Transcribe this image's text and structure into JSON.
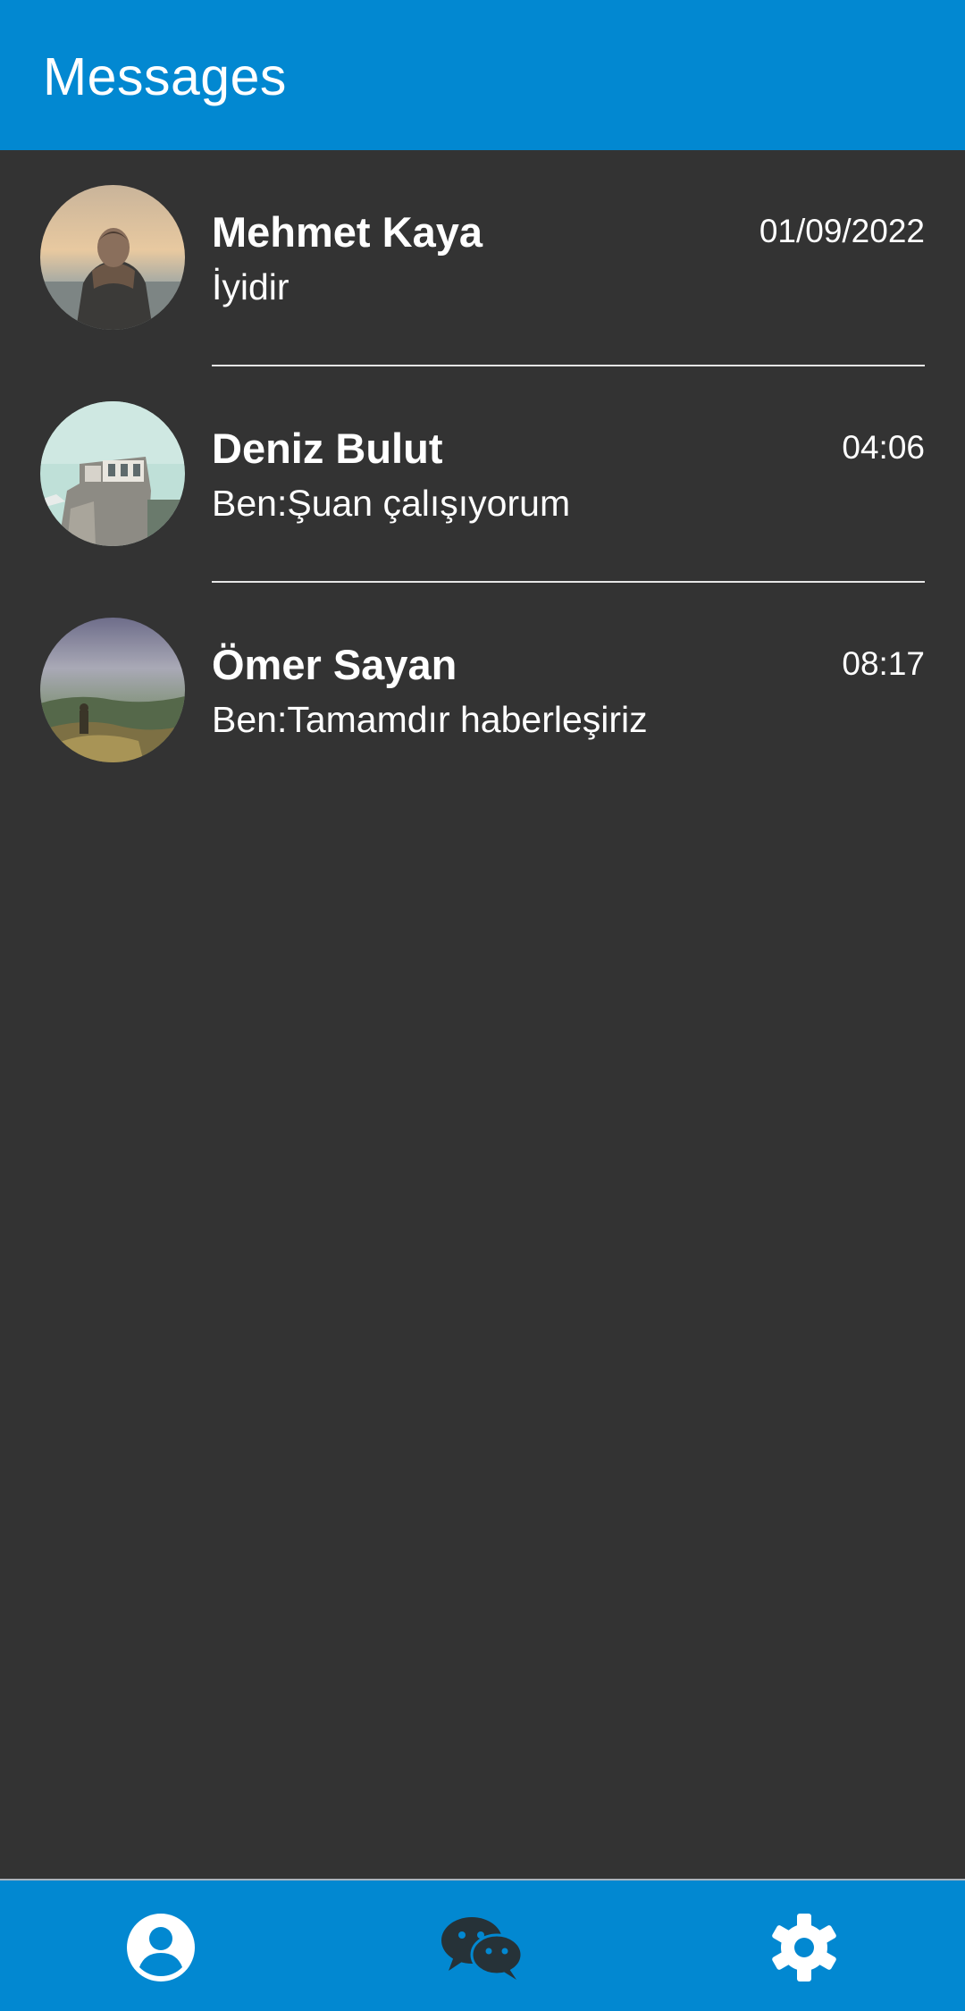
{
  "app_bar": {
    "title": "Messages",
    "background": "#0288d1"
  },
  "conversations": [
    {
      "name": "Mehmet Kaya",
      "time": "01/09/2022",
      "preview": "İyidir",
      "avatar": "photo-person-sunset"
    },
    {
      "name": "Deniz Bulut",
      "time": "04:06",
      "preview": "Ben:Şuan çalışıyorum",
      "avatar": "photo-building-sky"
    },
    {
      "name": "Ömer Sayan",
      "time": "08:17",
      "preview": "Ben:Tamamdır haberleşiriz",
      "avatar": "photo-hill-landscape"
    }
  ],
  "bottom_nav": {
    "items": [
      {
        "icon": "profile-icon",
        "color": "#ffffff",
        "active": false
      },
      {
        "icon": "chat-icon",
        "color": "#263238",
        "active": true
      },
      {
        "icon": "settings-icon",
        "color": "#ffffff",
        "active": false
      }
    ]
  },
  "colors": {
    "background": "#333333",
    "accent": "#0288d1",
    "text": "#ffffff",
    "divider": "#e6e6e6"
  }
}
